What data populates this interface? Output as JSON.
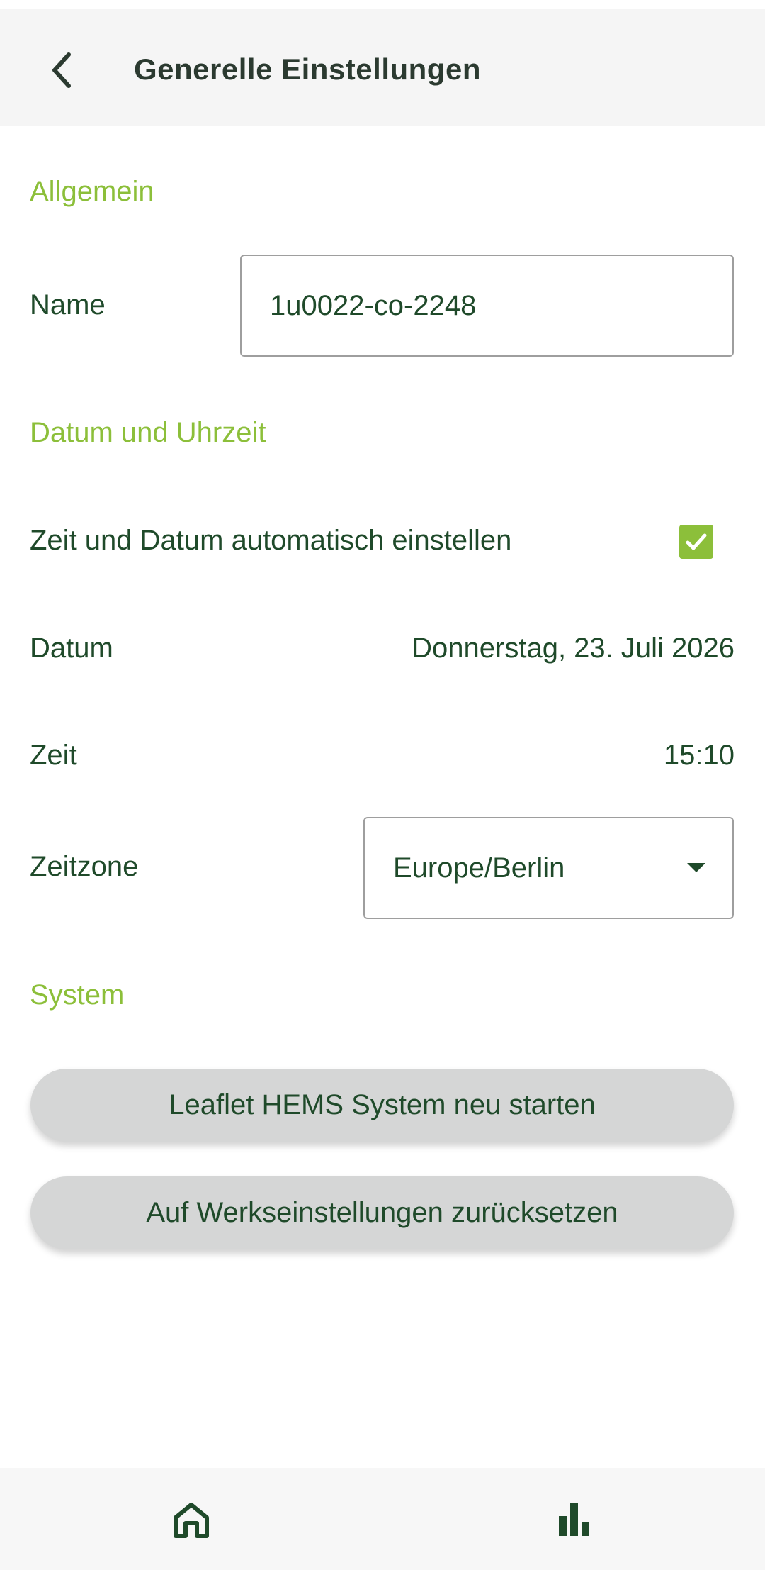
{
  "header": {
    "title": "Generelle Einstellungen",
    "back_icon": "chevron-left-icon"
  },
  "sections": {
    "general": "Allgemein",
    "datetime": "Datum und Uhrzeit",
    "system": "System"
  },
  "name": {
    "label": "Name",
    "value": "1u0022-co-2248"
  },
  "auto_time": {
    "label": "Zeit und Datum automatisch einstellen",
    "checked": true
  },
  "date": {
    "label": "Datum",
    "value": "Donnerstag, 23. Juli 2026"
  },
  "time": {
    "label": "Zeit",
    "value": "15:10"
  },
  "timezone": {
    "label": "Zeitzone",
    "selected": "Europe/Berlin"
  },
  "buttons": {
    "restart": "Leaflet HEMS System neu starten",
    "reset": "Auf Werkseinstellungen zurücksetzen"
  },
  "bottom_nav": {
    "items": [
      "home-icon",
      "bar-chart-icon"
    ]
  },
  "colors": {
    "accent": "#8cbf3a",
    "text": "#1f4a2a",
    "button_bg": "#d5d6d6"
  }
}
